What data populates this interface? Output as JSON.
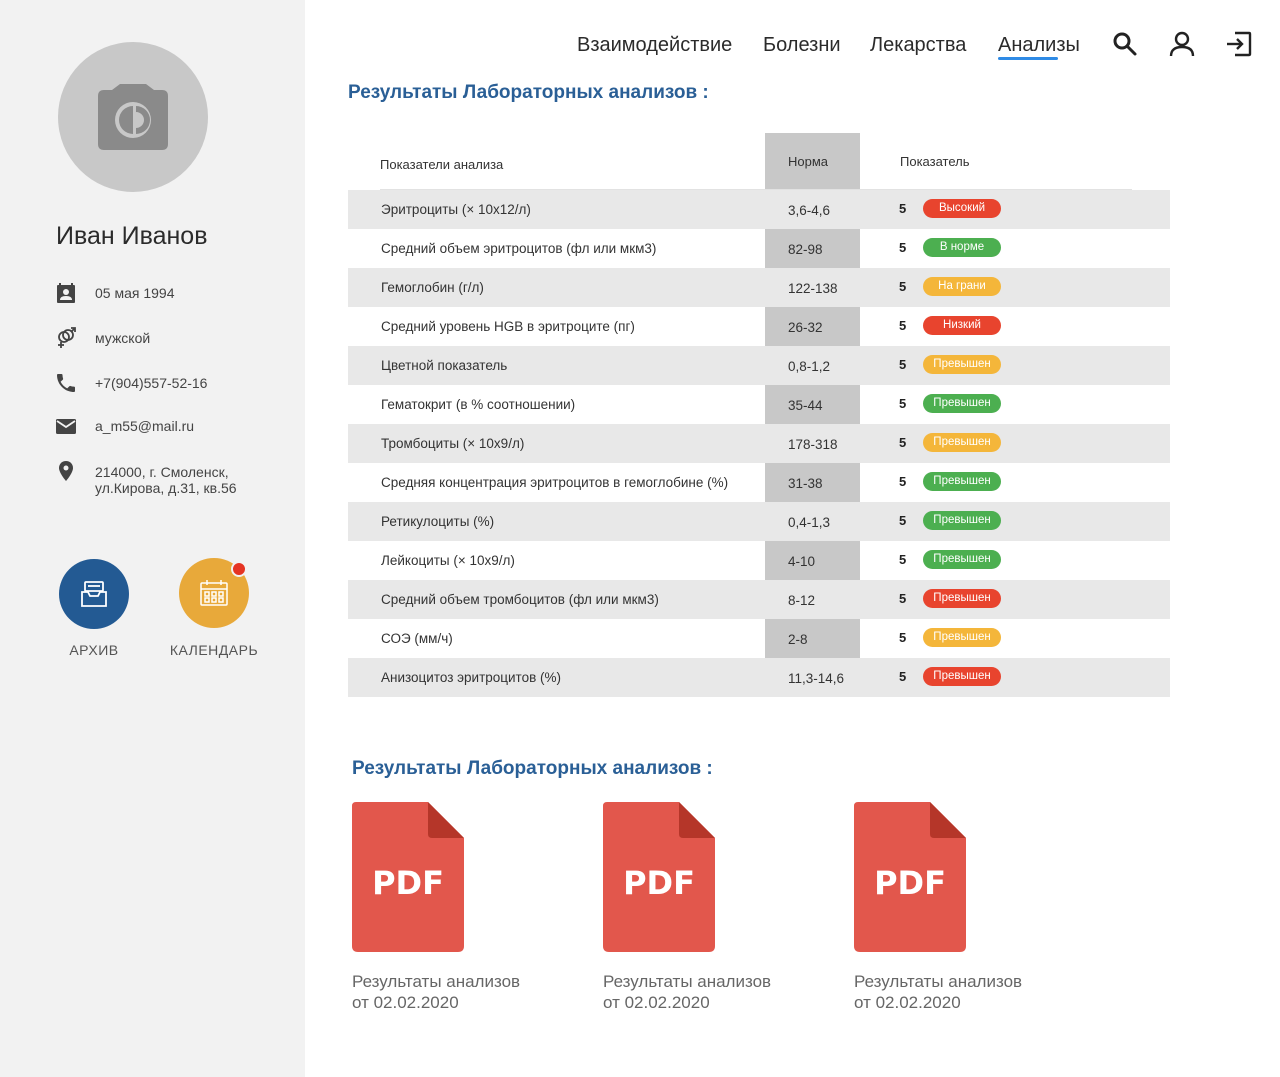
{
  "sidebar": {
    "name": "Иван Иванов",
    "birthdate": "05 мая 1994",
    "gender": "мужской",
    "phone": "+7(904)557-52-16",
    "email": "a_m55@mail.ru",
    "address_line1": "214000, г. Смоленск,",
    "address_line2": "ул.Кирова, д.31, кв.56",
    "archive_label": "АРХИВ",
    "calendar_label": "КАЛЕНДАРЬ"
  },
  "nav": {
    "items": [
      "Взаимодействие",
      "Болезни",
      "Лекарства",
      "Анализы"
    ],
    "active": "Анализы"
  },
  "lab": {
    "title": "Результаты Лабораторных анализов :",
    "headers": {
      "name": "Показатели анализа",
      "norm": "Норма",
      "value": "Показатель"
    },
    "rows": [
      {
        "name": "Эритроциты (× 10x12/л)",
        "norm": "3,6-4,6",
        "value": "5",
        "status": "Высокий",
        "color": "#e8442e"
      },
      {
        "name": "Средний объем эритроцитов (фл или мкм3)",
        "norm": "82-98",
        "value": "5",
        "status": "В норме",
        "color": "#4caf50"
      },
      {
        "name": "Гемоглобин (г/л)",
        "norm": "122-138",
        "value": "5",
        "status": "На грани",
        "color": "#f4b63a"
      },
      {
        "name": "Средний уровень HGB в эритроците (пг)",
        "norm": "26-32",
        "value": "5",
        "status": "Низкий",
        "color": "#e8442e"
      },
      {
        "name": "Цветной показатель",
        "norm": "0,8-1,2",
        "value": "5",
        "status": "Превышен",
        "color": "#f4b63a"
      },
      {
        "name": "Гематокрит (в % соотношении)",
        "norm": "35-44",
        "value": "5",
        "status": "Превышен",
        "color": "#4caf50"
      },
      {
        "name": "Тромбоциты (× 10x9/л)",
        "norm": "178-318",
        "value": "5",
        "status": "Превышен",
        "color": "#f4b63a"
      },
      {
        "name": "Средняя концентрация эритроцитов в гемоглобине (%)",
        "norm": "31-38",
        "value": "5",
        "status": "Превышен",
        "color": "#4caf50"
      },
      {
        "name": "Ретикулоциты (%)",
        "norm": "0,4-1,3",
        "value": "5",
        "status": "Превышен",
        "color": "#4caf50"
      },
      {
        "name": "Лейкоциты (× 10x9/л)",
        "norm": "4-10",
        "value": "5",
        "status": "Превышен",
        "color": "#4caf50"
      },
      {
        "name": "Средний объем тромбоцитов (фл или мкм3)",
        "norm": "8-12",
        "value": "5",
        "status": "Превышен",
        "color": "#e8442e"
      },
      {
        "name": "СОЭ (мм/ч)",
        "norm": "2-8",
        "value": "5",
        "status": "Превышен",
        "color": "#f4b63a"
      },
      {
        "name": "Анизоцитоз эритроцитов (%)",
        "norm": "11,3-14,6",
        "value": "5",
        "status": "Превышен",
        "color": "#e8442e"
      }
    ]
  },
  "files": {
    "title": "Результаты Лабораторных анализов :",
    "items": [
      {
        "badge": "PDF",
        "line1": "Результаты анализов",
        "line2": "от 02.02.2020"
      },
      {
        "badge": "PDF",
        "line1": "Результаты анализов",
        "line2": "от 02.02.2020"
      },
      {
        "badge": "PDF",
        "line1": "Результаты анализов",
        "line2": "от 02.02.2020"
      }
    ]
  },
  "colors": {
    "accent": "#2a5f96",
    "archive_button": "#235a93",
    "calendar_button": "#e8a93a",
    "pdf": "#e2574c",
    "pdf_fold": "#b53629"
  },
  "icons": [
    "camera-icon",
    "calendar-contact-icon",
    "gender-icon",
    "phone-icon",
    "mail-icon",
    "location-icon",
    "archive-icon",
    "calendar-icon",
    "search-icon",
    "user-icon",
    "logout-icon",
    "pdf-icon"
  ]
}
